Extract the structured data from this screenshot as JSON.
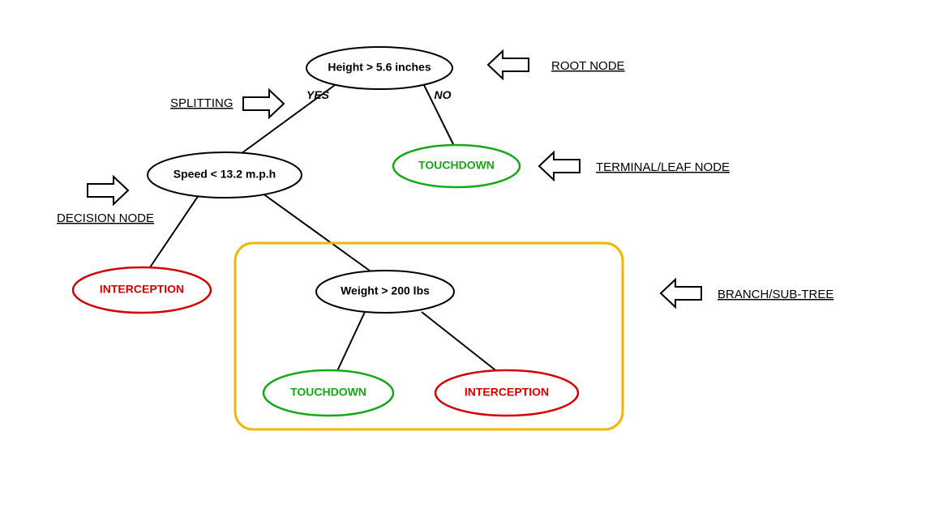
{
  "nodes": {
    "root": {
      "label": "Height > 5.6 inches"
    },
    "speed": {
      "label": "Speed < 13.2 m.p.h"
    },
    "weight": {
      "label": "Weight > 200 lbs"
    },
    "touchdown1": {
      "label": "TOUCHDOWN"
    },
    "interception1": {
      "label": "INTERCEPTION"
    },
    "touchdown2": {
      "label": "TOUCHDOWN"
    },
    "interception2": {
      "label": "INTERCEPTION"
    }
  },
  "branches": {
    "yes": "YES",
    "no": "NO"
  },
  "annotations": {
    "root_node": "ROOT NODE",
    "splitting": "SPLITTING",
    "terminal_leaf": "TERMINAL/LEAF NODE",
    "decision_node": "DECISION NODE",
    "branch_subtree": "BRANCH/SUB-TREE"
  }
}
